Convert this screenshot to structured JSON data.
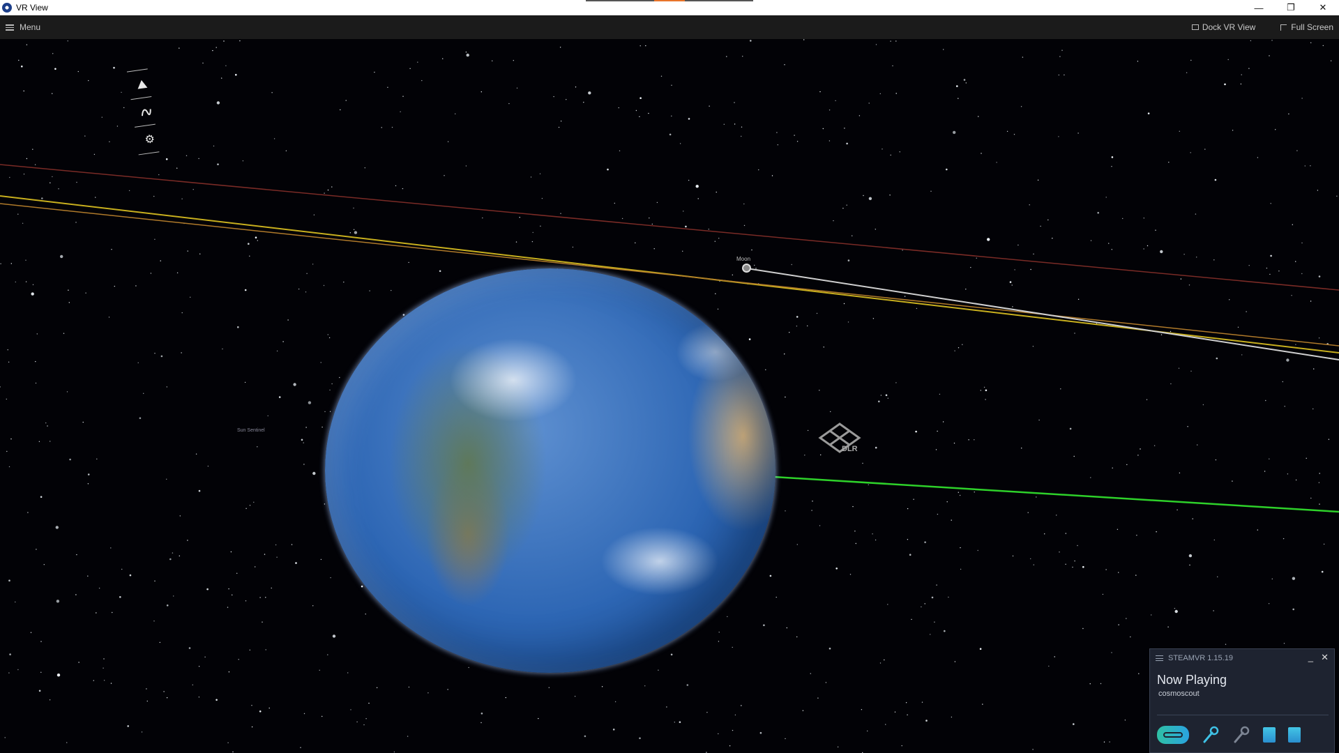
{
  "window": {
    "title": "VR View",
    "controls": {
      "minimize": "—",
      "restore": "❐",
      "close": "✕"
    }
  },
  "toolbar": {
    "menu_label": "Menu",
    "dock_label": "Dock VR View",
    "fullscreen_label": "Full Screen"
  },
  "scene": {
    "moon_label": "Moon",
    "sun_label": "Sun Sentinel",
    "logo_text": "DLR",
    "vr_tools": [
      "triangle-icon",
      "route-icon",
      "gear-icon"
    ]
  },
  "steamvr": {
    "title": "STEAMVR 1.15.19",
    "now_playing_label": "Now Playing",
    "app_name": "cosmoscout",
    "minimize": "_",
    "close": "✕",
    "status_icons": [
      "headset-icon",
      "controller-icon",
      "controller-inactive-icon",
      "base-station-icon",
      "base-station-icon"
    ]
  },
  "colors": {
    "accent_orange": "#e8742a",
    "orbit_yellow": "#c9b01e",
    "orbit_red": "#7a2b26",
    "orbit_green": "#2ed12a",
    "orbit_white": "#d0d0d0",
    "steamvr_teal": "#2fc0a4",
    "steamvr_blue": "#2a8fd0"
  }
}
